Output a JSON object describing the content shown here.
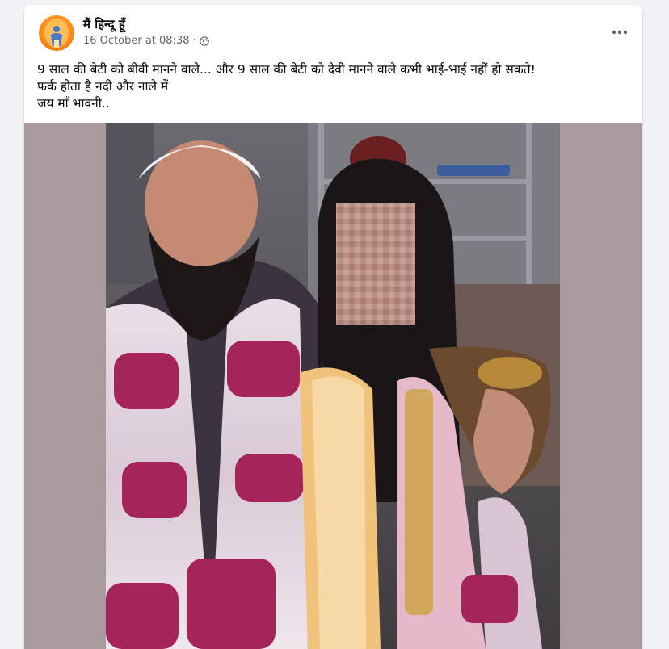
{
  "post": {
    "author": "मैं हिन्दू हूँ",
    "timestamp": "16 October at 08:38",
    "separator": "·",
    "privacy_icon": "globe-icon",
    "text_lines": [
      "9 साल की बेटी को बीवी मानने वाले... और 9 साल की बेटी को देवी मानने वाले कभी भाई-भाई नहीं हो सकते!",
      "फर्क होता है नदी और नाले में",
      "जय माँ भावनी.."
    ]
  },
  "colors": {
    "photo_background": "#a99a9e",
    "avatar": "#ff8c1a",
    "meta_text": "#65676b"
  }
}
